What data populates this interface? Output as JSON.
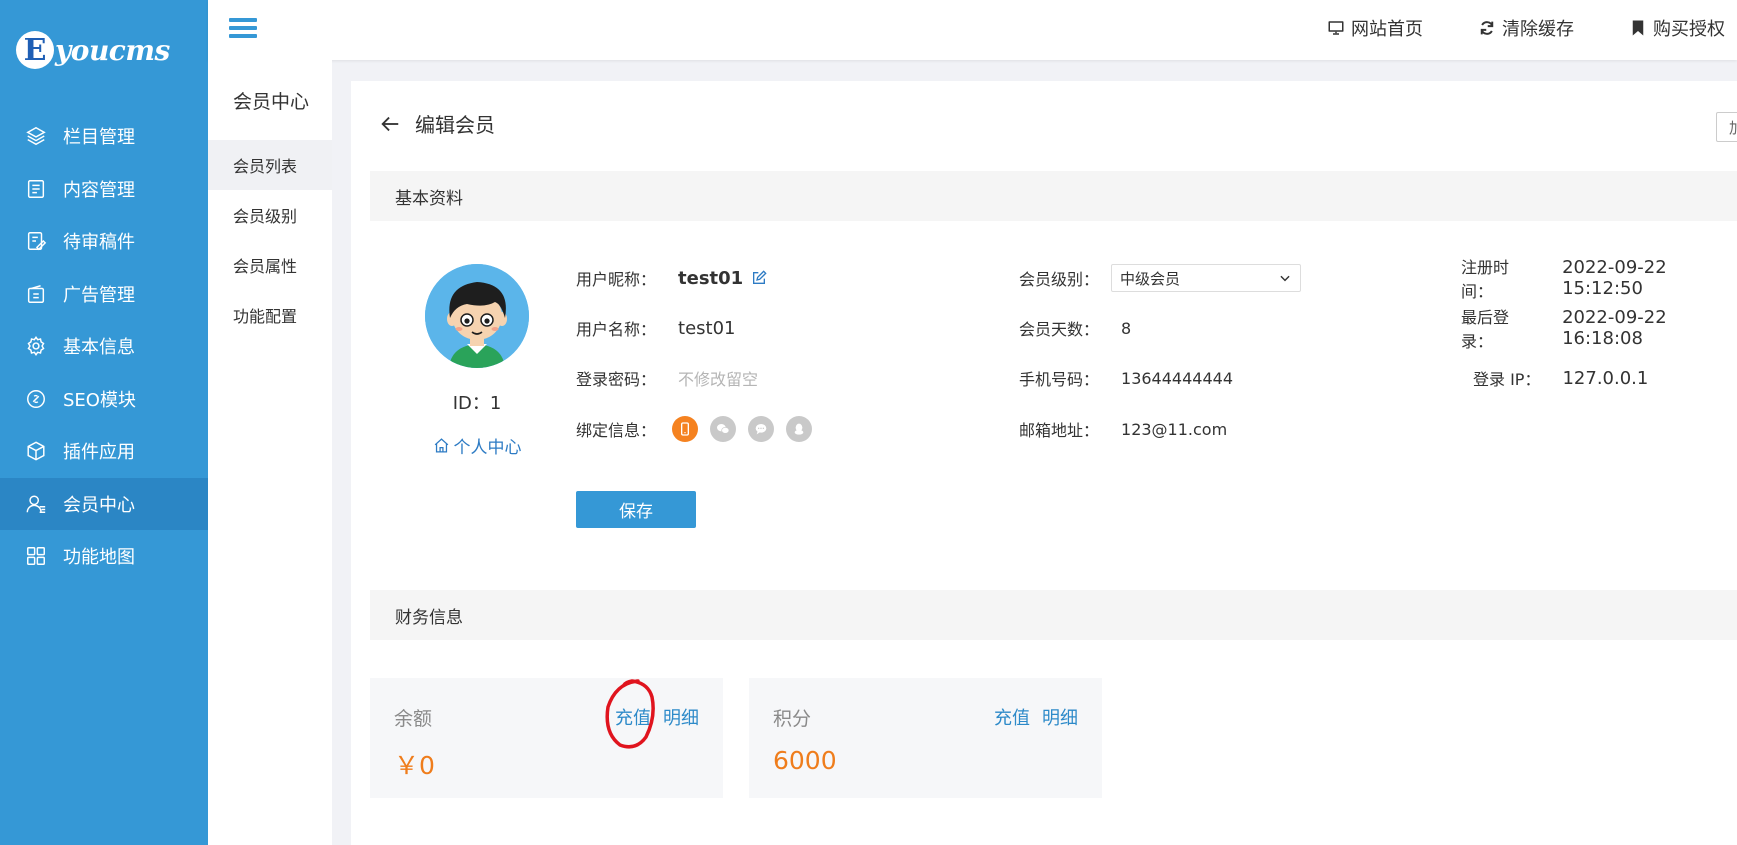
{
  "brand": {
    "badge": "E",
    "text": "youcms"
  },
  "sidebar": {
    "items": [
      {
        "label": "栏目管理",
        "icon": "layers-icon"
      },
      {
        "label": "内容管理",
        "icon": "document-icon"
      },
      {
        "label": "待审稿件",
        "icon": "pending-icon"
      },
      {
        "label": "广告管理",
        "icon": "ad-icon"
      },
      {
        "label": "基本信息",
        "icon": "gear-icon"
      },
      {
        "label": "SEO模块",
        "icon": "link-icon"
      },
      {
        "label": "插件应用",
        "icon": "cube-icon"
      },
      {
        "label": "会员中心",
        "icon": "user-icon",
        "active": true
      },
      {
        "label": "功能地图",
        "icon": "grid-icon"
      }
    ]
  },
  "topbar": {
    "links": [
      {
        "label": "网站首页",
        "icon": "monitor-icon"
      },
      {
        "label": "清除缓存",
        "icon": "refresh-icon"
      },
      {
        "label": "购买授权",
        "icon": "bookmark-icon"
      }
    ]
  },
  "submenu": {
    "title": "会员中心",
    "items": [
      {
        "label": "会员列表",
        "active": true
      },
      {
        "label": "会员级别"
      },
      {
        "label": "会员属性"
      },
      {
        "label": "功能配置"
      }
    ]
  },
  "page": {
    "title": "编辑会员",
    "edge_button": "加"
  },
  "basic": {
    "section_title": "基本资料",
    "id_text": "ID：1",
    "personal_center": "个人中心",
    "nickname": {
      "label": "用户昵称：",
      "value": "test01"
    },
    "username": {
      "label": "用户名称：",
      "value": "test01"
    },
    "password": {
      "label": "登录密码：",
      "placeholder": "不修改留空"
    },
    "binding": {
      "label": "绑定信息："
    },
    "level": {
      "label": "会员级别：",
      "value": "中级会员"
    },
    "days": {
      "label": "会员天数：",
      "value": "8"
    },
    "phone": {
      "label": "手机号码：",
      "value": "13644444444"
    },
    "email": {
      "label": "邮箱地址：",
      "value": "123@11.com"
    },
    "reg_time": {
      "label": "注册时间：",
      "value": "2022-09-22 15:12:50"
    },
    "last_login": {
      "label": "最后登录：",
      "value": "2022-09-22 16:18:08"
    },
    "login_ip": {
      "label": "登录 IP：",
      "value": "127.0.0.1"
    },
    "save_label": "保存"
  },
  "finance": {
    "section_title": "财务信息",
    "balance": {
      "label": "余额",
      "value": "￥0",
      "recharge": "充值",
      "detail": "明细"
    },
    "points": {
      "label": "积分",
      "value": "6000",
      "recharge": "充值",
      "detail": "明细"
    }
  },
  "colors": {
    "sidebar": "#3598d6",
    "sidebar_active": "#2b86c5",
    "accent_orange": "#ef7d1c",
    "link_blue": "#2d8ac9",
    "annotation_red": "#e0141e"
  }
}
